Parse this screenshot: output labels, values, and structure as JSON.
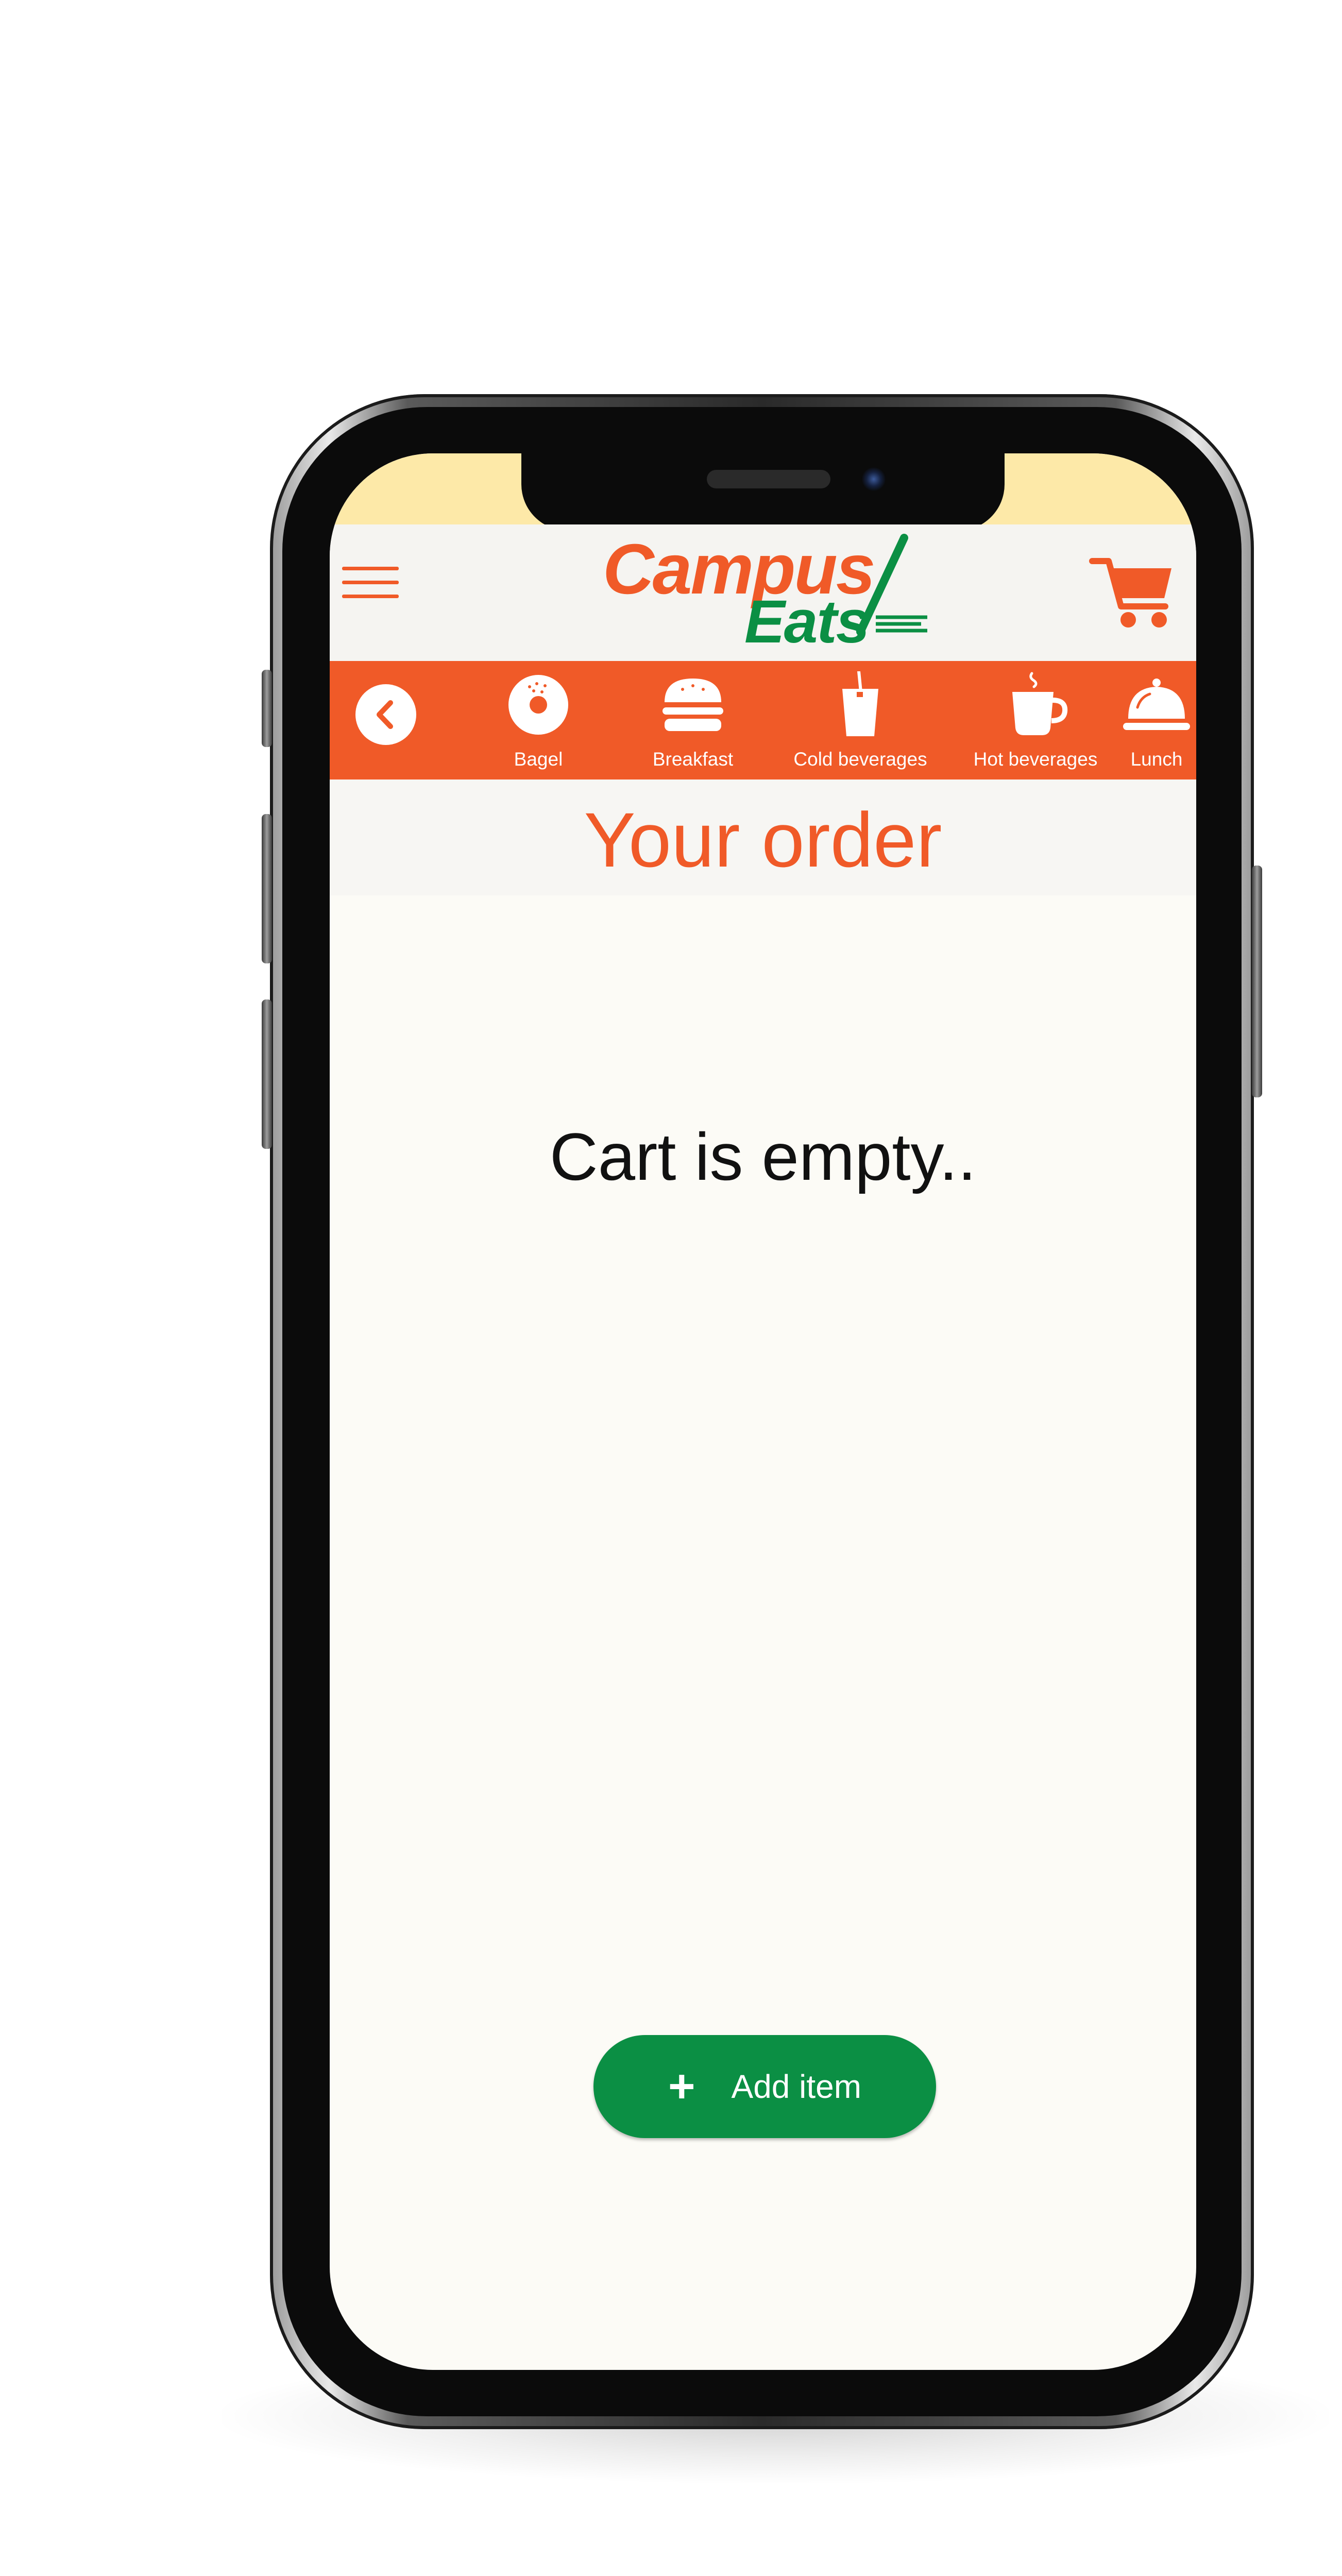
{
  "header": {
    "logo_line1": "Campus",
    "logo_line2": "Eats",
    "menu_icon": "hamburger-menu-icon",
    "cart_icon": "shopping-cart-icon"
  },
  "categories": [
    {
      "label": "Bagel",
      "icon": "bagel-icon"
    },
    {
      "label": "Breakfast",
      "icon": "burger-icon"
    },
    {
      "label": "Cold beverages",
      "icon": "cold-drink-icon"
    },
    {
      "label": "Hot beverages",
      "icon": "coffee-cup-icon"
    },
    {
      "label": "Lunch",
      "icon": "serving-dish-icon"
    }
  ],
  "order": {
    "title": "Your order",
    "empty_message": "Cart is empty..",
    "add_button": {
      "icon": "+",
      "label": "Add item"
    }
  },
  "colors": {
    "brand_orange": "#f05a28",
    "brand_green": "#0b8f44",
    "status_bar": "#fde9a8",
    "background": "#fcfbf6"
  }
}
